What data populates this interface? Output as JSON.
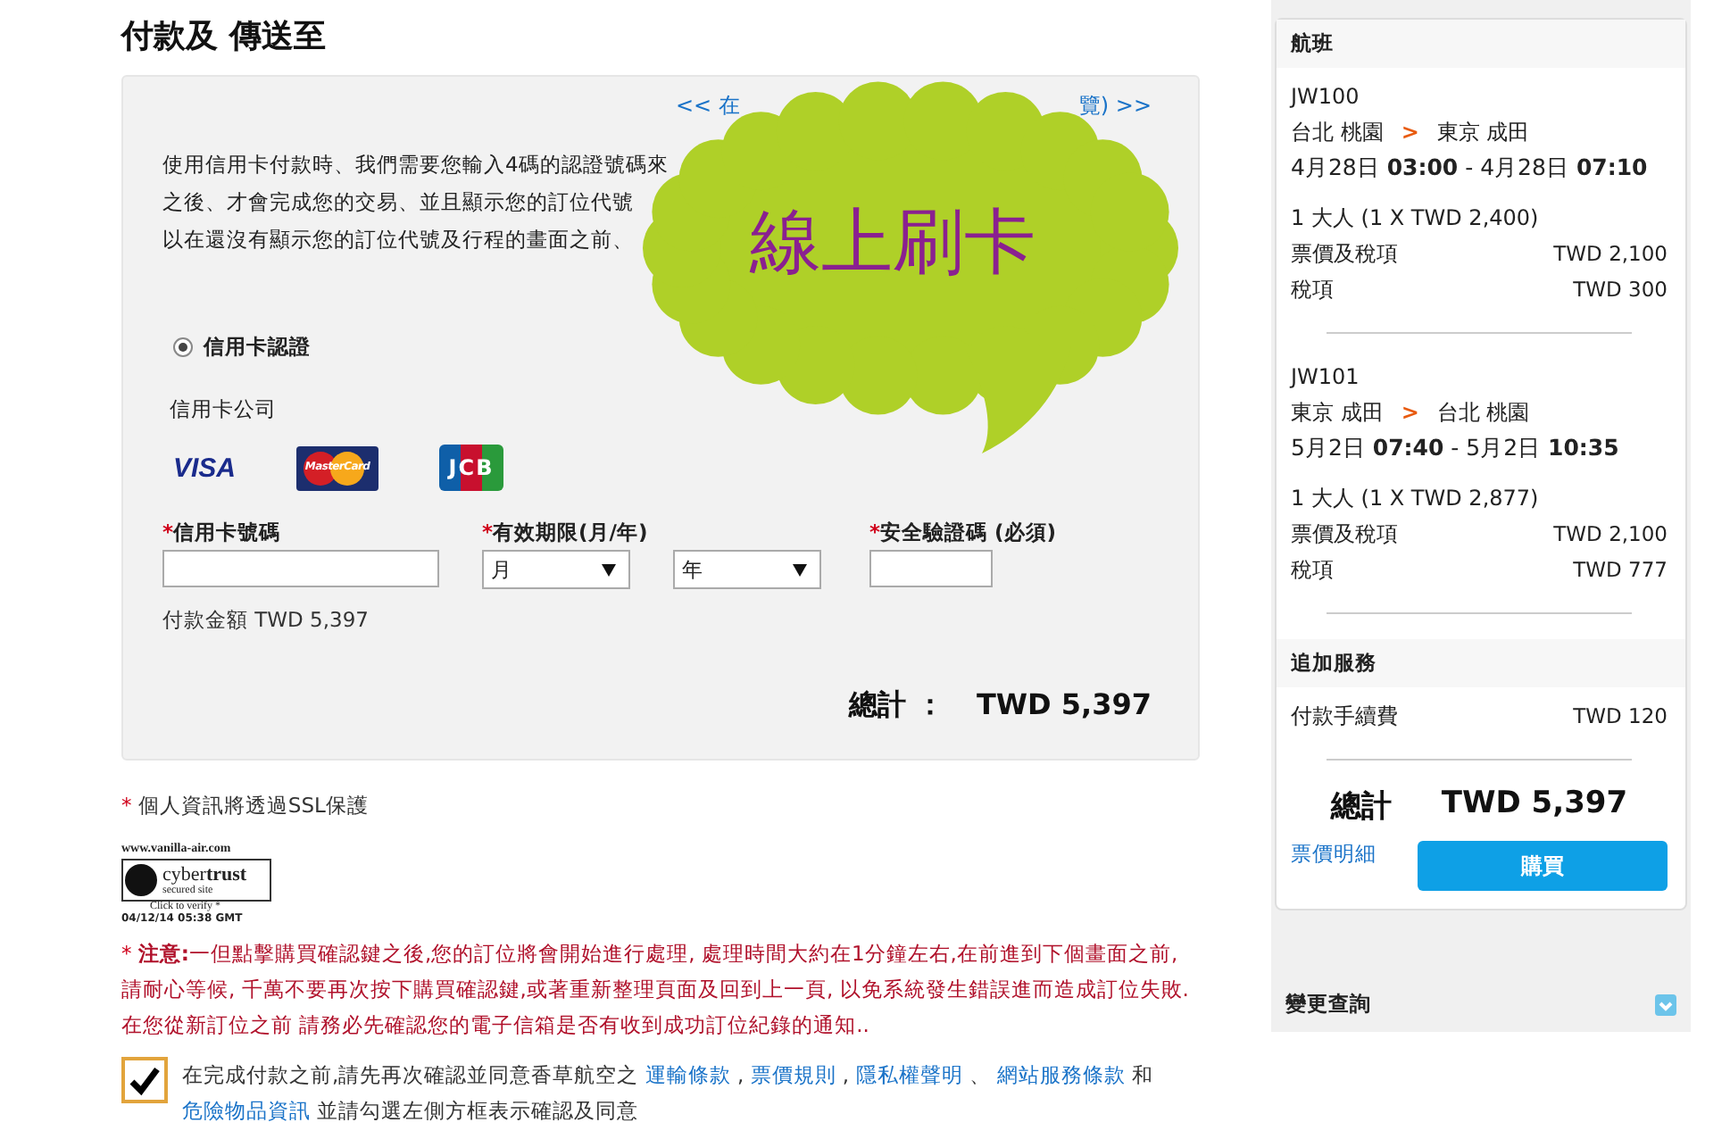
{
  "page_title": "付款及 傳送至",
  "payment": {
    "link_parts": [
      "<< 在",
      "覽) >>"
    ],
    "intro_lines": [
      "使用信用卡付款時、我們需要您輸入4碼的認證號碼來",
      "之後、才會完成您的交易、並且顯示您的訂位代號",
      "以在還沒有顯示您的訂位代號及行程的畫面之前、"
    ],
    "methods": [
      {
        "label": "信用卡認證",
        "selected": true
      }
    ],
    "card_company_label": "信用卡公司",
    "cards": [
      {
        "kind": "visa",
        "label": "VISA"
      },
      {
        "kind": "mastercard",
        "label": "MasterCard"
      },
      {
        "kind": "jcb",
        "label": "JCB"
      }
    ],
    "fields": [
      {
        "kind": "text",
        "mark": "*",
        "label": "信用卡號碼"
      },
      {
        "kind": "selects",
        "mark": "*",
        "label": "有效期限(月/年)",
        "options": [
          "月",
          "年"
        ]
      },
      {
        "kind": "short",
        "mark": "*",
        "label": "安全驗證碼 (必須)"
      }
    ],
    "amount": "付款金額 TWD 5,397",
    "total_label": "總計 ：",
    "total_value": "TWD 5,397"
  },
  "callout": {
    "text": "線上刷卡"
  },
  "ssl_mark": "*",
  "ssl_note": "個人資訊將透過SSL保護",
  "seal": {
    "site": "www.vanilla-air.com",
    "brand_a": "cyber",
    "brand_b": "trust",
    "sub": "secured site",
    "verify": "Click to verify *",
    "stamp": "04/12/14 05:38 GMT"
  },
  "notice": {
    "mark": "*",
    "lead": "注意:",
    "text": "一但點擊購買確認鍵之後,您的訂位將會開始進行處理, 處理時間大約在1分鐘左右,在前進到下個畫面之前, 請耐心等候, 千萬不要再次按下購買確認鍵,或著重新整理頁面及回到上一頁, 以免系統發生錯誤進而造成訂位失敗.在您從新訂位之前 請務必先確認您的電子信箱是否有收到成功訂位紀錄的通知.."
  },
  "agreement": {
    "checked": true,
    "parts": [
      {
        "kind": "text",
        "text": "在完成付款之前,請先再次確認並同意香草航空之"
      },
      {
        "kind": "link",
        "text": "運輸條款"
      },
      {
        "kind": "text",
        "text": ","
      },
      {
        "kind": "link",
        "text": "票價規則"
      },
      {
        "kind": "text",
        "text": ","
      },
      {
        "kind": "link",
        "text": "隱私權聲明"
      },
      {
        "kind": "text",
        "text": "、"
      },
      {
        "kind": "link",
        "text": "網站服務條款"
      },
      {
        "kind": "text",
        "text": "和"
      },
      {
        "kind": "link",
        "text": "危險物品資訊"
      },
      {
        "kind": "text",
        "text": "並請勾選左側方框表示確認及同意"
      }
    ]
  },
  "sidebar": {
    "header": "航班",
    "flights": [
      {
        "number": "JW100",
        "from": "台北 桃園",
        "arrow": ">",
        "to": "東京 成田",
        "time_a": "4月28日 ",
        "time_a_bold": "03:00",
        "sep": " - ",
        "time_b": "4月28日 ",
        "time_b_bold": "07:10",
        "pax": "1 大人 (1 X TWD 2,400)",
        "lines": [
          {
            "label": "票價及稅項",
            "value": "TWD 2,100"
          },
          {
            "label": "稅項",
            "value": "TWD 300"
          }
        ]
      },
      {
        "number": "JW101",
        "from": "東京 成田",
        "arrow": ">",
        "to": "台北 桃園",
        "time_a": "5月2日 ",
        "time_a_bold": "07:40",
        "sep": " - ",
        "time_b": "5月2日 ",
        "time_b_bold": "10:35",
        "pax": "1 大人 (1 X TWD 2,877)",
        "lines": [
          {
            "label": "票價及稅項",
            "value": "TWD 2,100"
          },
          {
            "label": "稅項",
            "value": "TWD 777"
          }
        ]
      }
    ],
    "extras_header": "追加服務",
    "extras": [
      {
        "label": "付款手續費",
        "value": "TWD 120"
      }
    ],
    "total_label": "總計",
    "total_value": "TWD 5,397",
    "details_link": "票價明細",
    "buy_button": "購買",
    "change_panel": {
      "title": "變更查詢",
      "expanded": false
    }
  }
}
